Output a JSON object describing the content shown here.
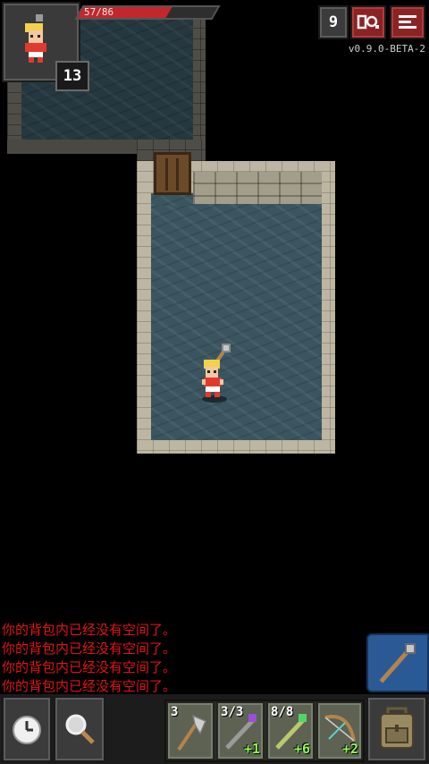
{
  "hud": {
    "hp_text": "57/86",
    "hp_fraction": 0.66,
    "level": "13",
    "depth": "9",
    "version": "v0.9.0-BETA-2"
  },
  "log": {
    "messages": [
      "你的背包内已经没有空间了。",
      "你的背包内已经没有空间了。",
      "你的背包内已经没有空间了。",
      "你的背包内已经没有空间了。"
    ]
  },
  "quickslots": [
    {
      "name": "axe",
      "qty": "3",
      "bonus": ""
    },
    {
      "name": "purple-wand",
      "qty": "3/3",
      "bonus": "+1"
    },
    {
      "name": "green-wand",
      "qty": "8/8",
      "bonus": "+6"
    },
    {
      "name": "bow",
      "qty": "",
      "bonus": "+2"
    }
  ],
  "colors": {
    "log_text": "#e01515",
    "hp_bar": "#c1272d",
    "bonus_text": "#8ffc4e",
    "attack_button": "#2a5a96"
  },
  "icons": {
    "wait": "clock-icon",
    "search": "magnifier-icon",
    "journal": "journal-icon",
    "menu": "menu-icon",
    "backpack": "backpack-icon",
    "attack": "staff-icon"
  }
}
